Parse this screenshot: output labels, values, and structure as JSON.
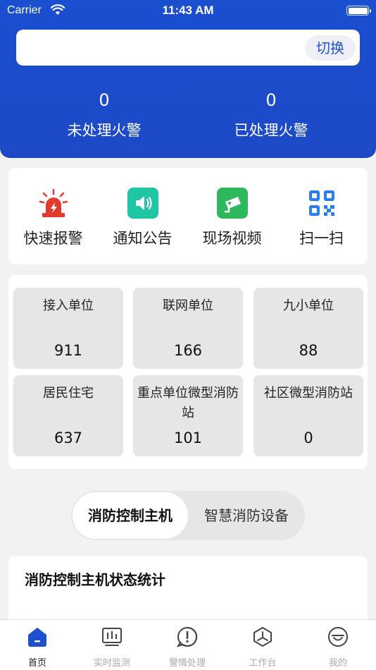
{
  "status_bar": {
    "carrier": "Carrier",
    "time": "11:43 AM"
  },
  "search": {
    "value": "",
    "switch_label": "切换"
  },
  "alarms": [
    {
      "count": "0",
      "label": "未处理火警"
    },
    {
      "count": "0",
      "label": "已处理火警"
    }
  ],
  "quick_actions": [
    {
      "label": "快速报警",
      "icon": "alarm-light-icon"
    },
    {
      "label": "通知公告",
      "icon": "speaker-icon"
    },
    {
      "label": "现场视频",
      "icon": "camera-icon"
    },
    {
      "label": "扫一扫",
      "icon": "qr-code-icon"
    }
  ],
  "units": [
    {
      "label": "接入单位",
      "value": "911"
    },
    {
      "label": "联网单位",
      "value": "166"
    },
    {
      "label": "九小单位",
      "value": "88"
    },
    {
      "label": "居民住宅",
      "value": "637"
    },
    {
      "label": "重点单位微型消防站",
      "value": "101"
    },
    {
      "label": "社区微型消防站",
      "value": "0"
    }
  ],
  "segments": {
    "active": "消防控制主机",
    "inactive": "智慧消防设备"
  },
  "status_card": {
    "title": "消防控制主机状态统计"
  },
  "tabs": [
    {
      "label": "首页",
      "icon": "home-icon",
      "active": true
    },
    {
      "label": "实时监测",
      "icon": "monitor-icon",
      "active": false
    },
    {
      "label": "警情处理",
      "icon": "alert-icon",
      "active": false
    },
    {
      "label": "工作台",
      "icon": "workbench-icon",
      "active": false
    },
    {
      "label": "我的",
      "icon": "profile-icon",
      "active": false
    }
  ],
  "colors": {
    "primary": "#1d4fcf",
    "alarm_red": "#e23a2c",
    "teal": "#1fc6a4",
    "green": "#2eb85c",
    "qr_blue": "#2a7ff0"
  }
}
